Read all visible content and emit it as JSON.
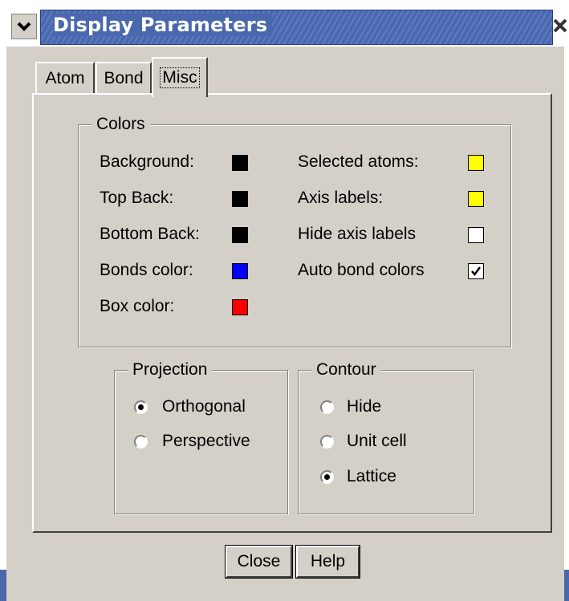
{
  "window": {
    "title": "Display Parameters",
    "title_color": "#4a68ad"
  },
  "tabs": [
    {
      "label": "Atom",
      "active": false
    },
    {
      "label": "Bond",
      "active": false
    },
    {
      "label": "Misc",
      "active": true
    }
  ],
  "colors_group": {
    "title": "Colors",
    "left": [
      {
        "label": "Background:",
        "color": "#000000"
      },
      {
        "label": "Top Back:",
        "color": "#000000"
      },
      {
        "label": "Bottom Back:",
        "color": "#000000"
      },
      {
        "label": "Bonds color:",
        "color": "#0000ff"
      },
      {
        "label": "Box color:",
        "color": "#ff0000"
      }
    ],
    "right": [
      {
        "label": "Selected atoms:",
        "type": "swatch",
        "color": "#ffff00"
      },
      {
        "label": "Axis labels:",
        "type": "swatch",
        "color": "#ffff00"
      },
      {
        "label": "Hide axis labels",
        "type": "checkbox",
        "checked": false
      },
      {
        "label": "Auto bond colors",
        "type": "checkbox",
        "checked": true
      }
    ]
  },
  "projection_group": {
    "title": "Projection",
    "options": [
      {
        "label": "Orthogonal",
        "selected": true
      },
      {
        "label": "Perspective",
        "selected": false
      }
    ]
  },
  "contour_group": {
    "title": "Contour",
    "options": [
      {
        "label": "Hide",
        "selected": false
      },
      {
        "label": "Unit cell",
        "selected": false
      },
      {
        "label": "Lattice",
        "selected": true
      }
    ]
  },
  "buttons": {
    "close": "Close",
    "help": "Help"
  },
  "icons": {
    "window_menu": "chevron-down-icon",
    "window_close": "close-icon"
  }
}
